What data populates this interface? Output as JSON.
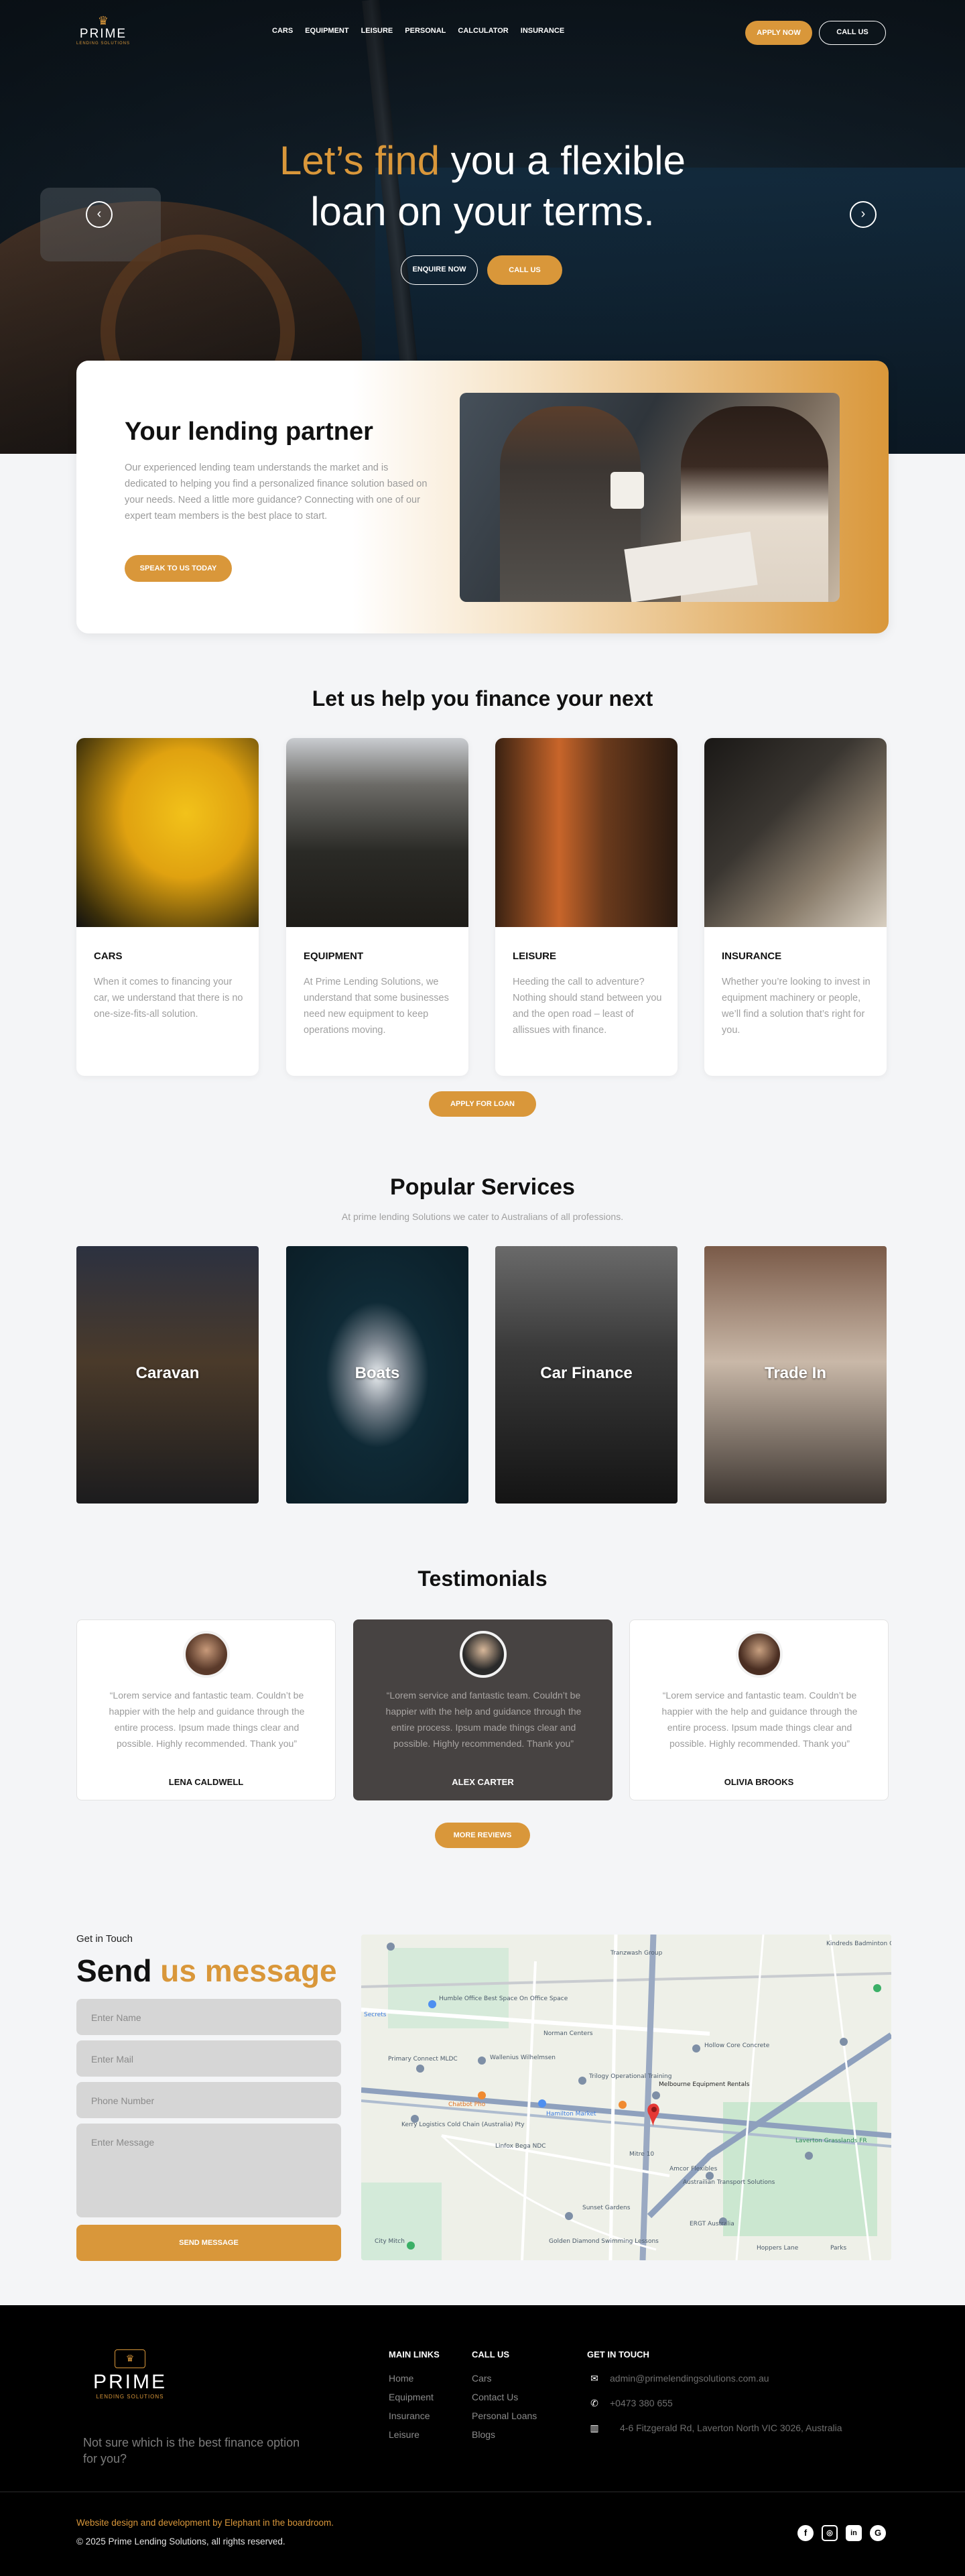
{
  "brand": {
    "name": "PRIME",
    "tagline": "LENDING SOLUTIONS"
  },
  "nav": {
    "items": [
      "CARS",
      "EQUIPMENT",
      "LEISURE",
      "PERSONAL",
      "CALCULATOR",
      "INSURANCE"
    ],
    "apply_now": "APPLY NOW",
    "call_us": "CALL US"
  },
  "hero": {
    "title_highlight": "Let’s find",
    "title_rest_1": " you a flexible",
    "title_line2": "loan on your terms.",
    "enquire_now": "ENQUIRE NOW",
    "call_us": "CALL US",
    "prev_icon": "chevron-left-icon",
    "next_icon": "chevron-right-icon"
  },
  "partner": {
    "title": "Your lending partner",
    "text": "Our experienced lending team understands the market and is dedicated to helping you find a personalized finance solution based on your needs. Need a little more guidance? Connecting with one of our expert team members is the best place to start.",
    "button": "SPEAK TO US TODAY"
  },
  "finance": {
    "title": "Let us help you finance your next",
    "cards": [
      {
        "title": "CARS",
        "text": "When it comes to financing your car, we understand that there is no one-size-fits-all solution."
      },
      {
        "title": "EQUIPMENT",
        "text": "At Prime Lending Solutions, we understand that some businesses need new equipment to keep operations moving."
      },
      {
        "title": "LEISURE",
        "text": "Heeding the call to adventure? Nothing should stand between you and the open road – least of allissues with finance."
      },
      {
        "title": "INSURANCE",
        "text": "Whether you’re looking to invest in equipment machinery or people, we’ll find a solution that’s right for you."
      }
    ],
    "button": "APPLY FOR LOAN"
  },
  "services": {
    "title": "Popular Services",
    "subtitle": "At prime lending Solutions we cater to Australians of all professions.",
    "items": [
      "Caravan",
      "Boats",
      "Car Finance",
      "Trade In"
    ]
  },
  "testimonials": {
    "title": "Testimonials",
    "items": [
      {
        "quote": "“Lorem service and fantastic team. Couldn’t be happier with the help and guidance through the entire process. Ipsum made things clear and possible. Highly recommended. Thank you”",
        "name": "LENA CALDWELL"
      },
      {
        "quote": "“Lorem service and fantastic team. Couldn’t be happier with the help and guidance through the entire process. Ipsum made things clear and possible. Highly recommended. Thank you”",
        "name": "ALEX CARTER"
      },
      {
        "quote": "“Lorem service and fantastic team. Couldn’t be happier with the help and guidance through the entire process. Ipsum made things clear and possible. Highly recommended. Thank you”",
        "name": "OLIVIA BROOKS"
      }
    ],
    "button": "MORE REVIEWS"
  },
  "contact": {
    "eyebrow": "Get in Touch",
    "title_1": "Send",
    "title_2": " us message",
    "name_placeholder": "Enter Name",
    "mail_placeholder": "Enter Mail",
    "phone_placeholder": "Phone Number",
    "message_placeholder": "Enter Message",
    "button": "SEND MESSAGE",
    "map_labels": [
      "Tranzwash Group",
      "Kindreds Badminton Centre",
      "Humble Office Best Space On Office Space",
      "Secrets",
      "Primary Connect MLDC",
      "Norman Centers",
      "Wallenius Wilhelmsen",
      "Trilogy Operational Training",
      "Hollow Core Concrete",
      "Melbourne Equipment Rentals",
      "Chatbot Pho",
      "Kerry Logistics Cold Chain (Australia) Pty",
      "Hamilton Market",
      "Linfox Bega NDC",
      "Laverton Grasslands FR",
      "Mitre 10",
      "Amcor Flexibles",
      "Austrailian Transport Solutions",
      "ERGT Australia",
      "Sunset Gardens",
      "Golden Diamond Swimming Lessons",
      "City Mitch",
      "Hoppers Lane",
      "Parks"
    ]
  },
  "footer": {
    "tagline": "Not sure which is the best finance option for you?",
    "main_links_title": "MAIN LINKS",
    "main_links": [
      "Home",
      "Equipment",
      "Insurance",
      "Leisure"
    ],
    "call_us_title": "CALL US",
    "call_us_links": [
      "Cars",
      "Contact Us",
      "Personal Loans",
      "Blogs"
    ],
    "get_in_touch_title": "GET IN TOUCH",
    "email": "admin@primelendingsolutions.com.au",
    "phone": "+0473 380 655",
    "address": "4-6 Fitzgerald Rd, Laverton North VIC 3026, Australia",
    "credit": "Website design and development by Elephant in the boardroom.",
    "copyright": "© 2025 Prime Lending Solutions, all rights reserved.",
    "social": [
      "facebook-icon",
      "instagram-icon",
      "linkedin-icon",
      "google-icon"
    ]
  },
  "colors": {
    "accent": "#d9973a",
    "dark": "#000000",
    "card_dark": "#474342"
  }
}
